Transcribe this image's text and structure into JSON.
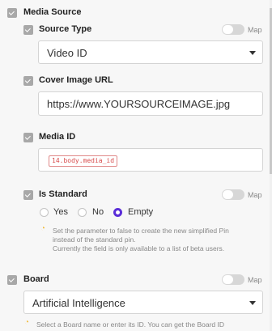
{
  "media_source": {
    "label": "Media Source"
  },
  "source_type": {
    "label": "Source Type",
    "map_label": "Map",
    "selected": "Video ID"
  },
  "cover_image": {
    "label": "Cover Image URL",
    "value": "https://www.YOURSOURCEIMAGE.jpg"
  },
  "media_id": {
    "label": "Media ID",
    "token": "14.body.media_id"
  },
  "is_standard": {
    "label": "Is Standard",
    "map_label": "Map",
    "options": [
      "Yes",
      "No",
      "Empty"
    ],
    "selected": "Empty",
    "hint_line1": "Set the parameter to false to create the new simplified Pin",
    "hint_line2": "instead of the standard pin.",
    "hint_line3": "Currently the field is only available to a list of beta users."
  },
  "board": {
    "label": "Board",
    "map_label": "Map",
    "selected": "Artificial Intelligence",
    "hint": "Select a Board name or enter its ID. You can get the Board ID"
  },
  "colors": {
    "accent": "#5b2ed8",
    "token": "#d84c4c",
    "hint_icon": "#f2c04a"
  }
}
